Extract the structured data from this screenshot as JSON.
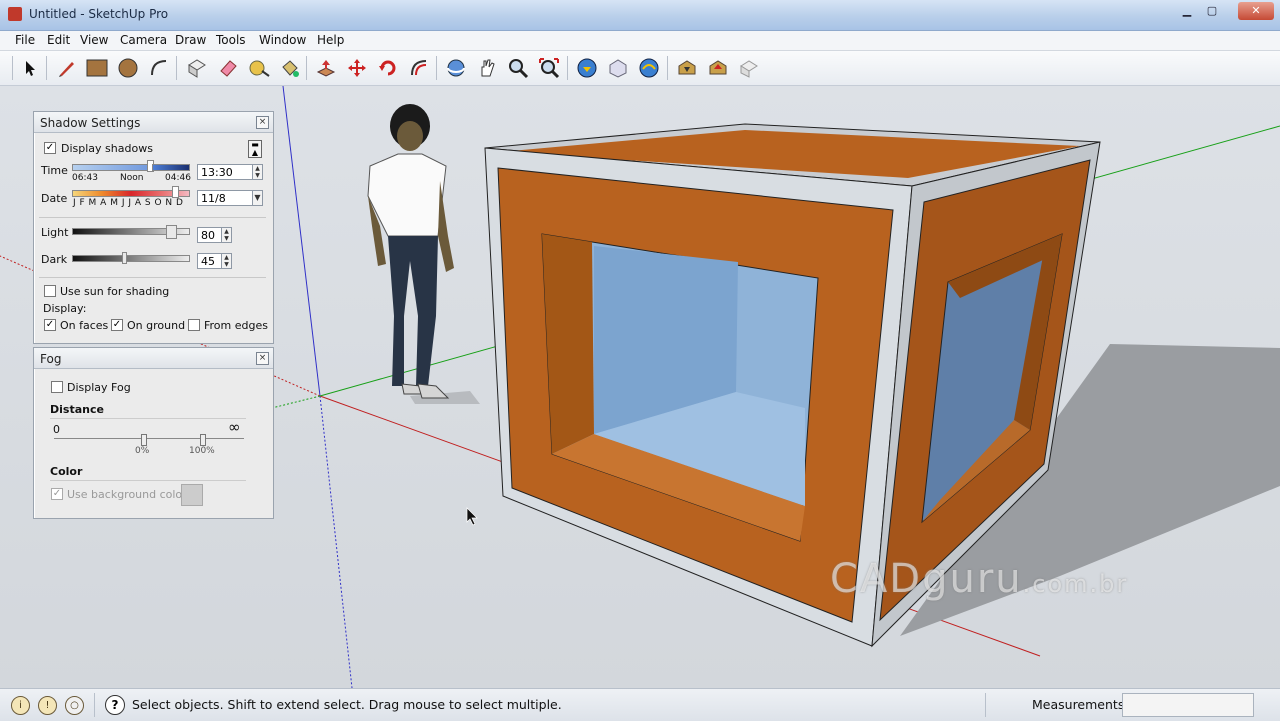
{
  "window": {
    "title": "Untitled - SketchUp Pro"
  },
  "menu": [
    "File",
    "Edit",
    "View",
    "Camera",
    "Draw",
    "Tools",
    "Window",
    "Help"
  ],
  "toolbar_icons": [
    "select-icon",
    "pencil-icon",
    "rectangle-icon",
    "circle-icon",
    "arc-icon",
    "make-component-icon",
    "eraser-icon",
    "tape-measure-icon",
    "paint-bucket-icon",
    "push-pull-icon",
    "move-icon",
    "rotate-icon",
    "offset-icon",
    "orbit-icon",
    "pan-icon",
    "zoom-icon",
    "zoom-extents-icon",
    "get-models-icon",
    "share-model-icon",
    "share-component-icon",
    "warehouse-icon",
    "extension-icon",
    "style-icon"
  ],
  "shadow_panel": {
    "title": "Shadow Settings",
    "display_shadows": {
      "label": "Display shadows",
      "checked": true
    },
    "time": {
      "label": "Time",
      "start": "06:43",
      "noon": "Noon",
      "end": "04:46",
      "value": "13:30"
    },
    "date": {
      "label": "Date",
      "months": "J F M A M J J A S O N D",
      "value": "11/8"
    },
    "light": {
      "label": "Light",
      "value": "80"
    },
    "dark": {
      "label": "Dark",
      "value": "45"
    },
    "use_sun": {
      "label": "Use sun for shading",
      "checked": false
    },
    "display_label": "Display:",
    "on_faces": {
      "label": "On faces",
      "checked": true
    },
    "on_ground": {
      "label": "On ground",
      "checked": true
    },
    "from_edges": {
      "label": "From edges",
      "checked": false
    }
  },
  "fog_panel": {
    "title": "Fog",
    "display_fog": {
      "label": "Display Fog",
      "checked": false
    },
    "distance_label": "Distance",
    "distance_start": "0",
    "distance_end": "∞",
    "pct_start": "0%",
    "pct_end": "100%",
    "color_label": "Color",
    "use_bg": {
      "label": "Use background color",
      "checked": true
    }
  },
  "status": {
    "text": "Select objects. Shift to extend select. Drag mouse to select multiple.",
    "measurements_label": "Measurements",
    "measurements_value": ""
  },
  "watermark": {
    "main": "CADguru",
    "suffix": ".com.br"
  },
  "colors": {
    "wood": "#b8621f",
    "frame": "#d8dde2",
    "glass": "#8fb3d8",
    "red_axis": "#c02020",
    "green_axis": "#18a018",
    "blue_axis": "#2020c0"
  }
}
